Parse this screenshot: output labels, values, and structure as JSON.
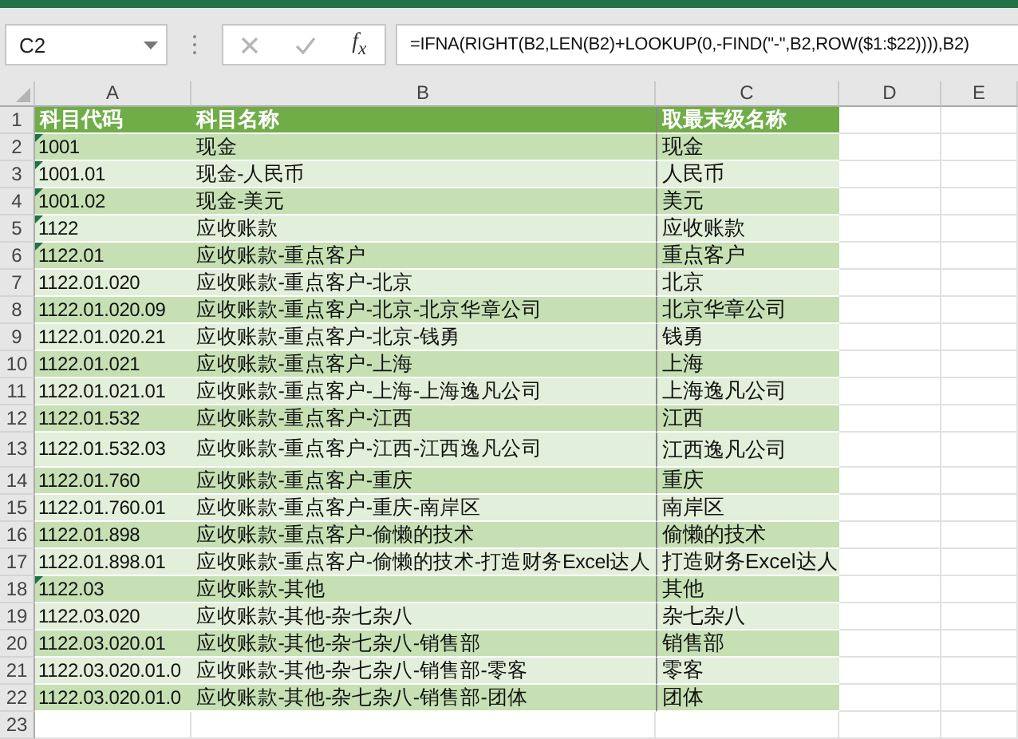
{
  "name_box": {
    "value": "C2"
  },
  "formula_bar": {
    "function_label": "f$_{x}$",
    "formula": "=IFNA(RIGHT(B2,LEN(B2)+LOOKUP(0,-FIND(\"-\",B2,ROW($1:$22)))),B2)"
  },
  "columns": [
    "A",
    "B",
    "C",
    "D",
    "E"
  ],
  "rows": [
    {
      "number": "1",
      "kind": "header",
      "cells": [
        "科目代码",
        "科目名称",
        "取最末级名称"
      ]
    },
    {
      "number": "2",
      "kind": "data",
      "flag": true,
      "cells": [
        "1001",
        "现金",
        "现金"
      ]
    },
    {
      "number": "3",
      "kind": "data",
      "flag": true,
      "cells": [
        "1001.01",
        "现金-人民币",
        "人民币"
      ]
    },
    {
      "number": "4",
      "kind": "data",
      "flag": true,
      "cells": [
        "1001.02",
        "现金-美元",
        "美元"
      ]
    },
    {
      "number": "5",
      "kind": "data",
      "flag": true,
      "cells": [
        "1122",
        "应收账款",
        "应收账款"
      ]
    },
    {
      "number": "6",
      "kind": "data",
      "flag": true,
      "cells": [
        "1122.01",
        "应收账款-重点客户",
        "重点客户"
      ]
    },
    {
      "number": "7",
      "kind": "data",
      "flag": false,
      "cells": [
        "1122.01.020",
        "应收账款-重点客户-北京",
        "北京"
      ]
    },
    {
      "number": "8",
      "kind": "data",
      "flag": false,
      "cells": [
        "1122.01.020.09",
        "应收账款-重点客户-北京-北京华章公司",
        "北京华章公司"
      ]
    },
    {
      "number": "9",
      "kind": "data",
      "flag": false,
      "cells": [
        "1122.01.020.21",
        "应收账款-重点客户-北京-钱勇",
        "钱勇"
      ]
    },
    {
      "number": "10",
      "kind": "data",
      "flag": false,
      "cells": [
        "1122.01.021",
        "应收账款-重点客户-上海",
        "上海"
      ]
    },
    {
      "number": "11",
      "kind": "data",
      "flag": false,
      "cells": [
        "1122.01.021.01",
        "应收账款-重点客户-上海-上海逸凡公司",
        "上海逸凡公司"
      ]
    },
    {
      "number": "12",
      "kind": "data",
      "flag": false,
      "cells": [
        "1122.01.532",
        "应收账款-重点客户-江西",
        "江西"
      ]
    },
    {
      "number": "13",
      "kind": "data",
      "flag": false,
      "cells": [
        "1122.01.532.03",
        "应收账款-重点客户-江西-江西逸凡公司",
        "江西逸凡公司"
      ]
    },
    {
      "number": "14",
      "kind": "data",
      "flag": false,
      "cells": [
        "1122.01.760",
        "应收账款-重点客户-重庆",
        "重庆"
      ]
    },
    {
      "number": "15",
      "kind": "data",
      "flag": false,
      "cells": [
        "1122.01.760.01",
        "应收账款-重点客户-重庆-南岸区",
        "南岸区"
      ]
    },
    {
      "number": "16",
      "kind": "data",
      "flag": false,
      "cells": [
        "1122.01.898",
        "应收账款-重点客户-偷懒的技术",
        "偷懒的技术"
      ]
    },
    {
      "number": "17",
      "kind": "data",
      "flag": false,
      "cells": [
        "1122.01.898.01",
        "应收账款-重点客户-偷懒的技术-打造财务Excel达人",
        "打造财务Excel达人"
      ]
    },
    {
      "number": "18",
      "kind": "data",
      "flag": true,
      "cells": [
        "1122.03",
        "应收账款-其他",
        "其他"
      ]
    },
    {
      "number": "19",
      "kind": "data",
      "flag": false,
      "cells": [
        "1122.03.020",
        "应收账款-其他-杂七杂八",
        "杂七杂八"
      ]
    },
    {
      "number": "20",
      "kind": "data",
      "flag": false,
      "cells": [
        "1122.03.020.01",
        "应收账款-其他-杂七杂八-销售部",
        "销售部"
      ]
    },
    {
      "number": "21",
      "kind": "data",
      "flag": false,
      "cells": [
        "1122.03.020.01.0",
        "应收账款-其他-杂七杂八-销售部-零客",
        "零客"
      ]
    },
    {
      "number": "22",
      "kind": "data",
      "flag": false,
      "cells": [
        "1122.03.020.01.0",
        "应收账款-其他-杂七杂八-销售部-团体",
        "团体"
      ]
    },
    {
      "number": "23",
      "kind": "blank"
    }
  ]
}
